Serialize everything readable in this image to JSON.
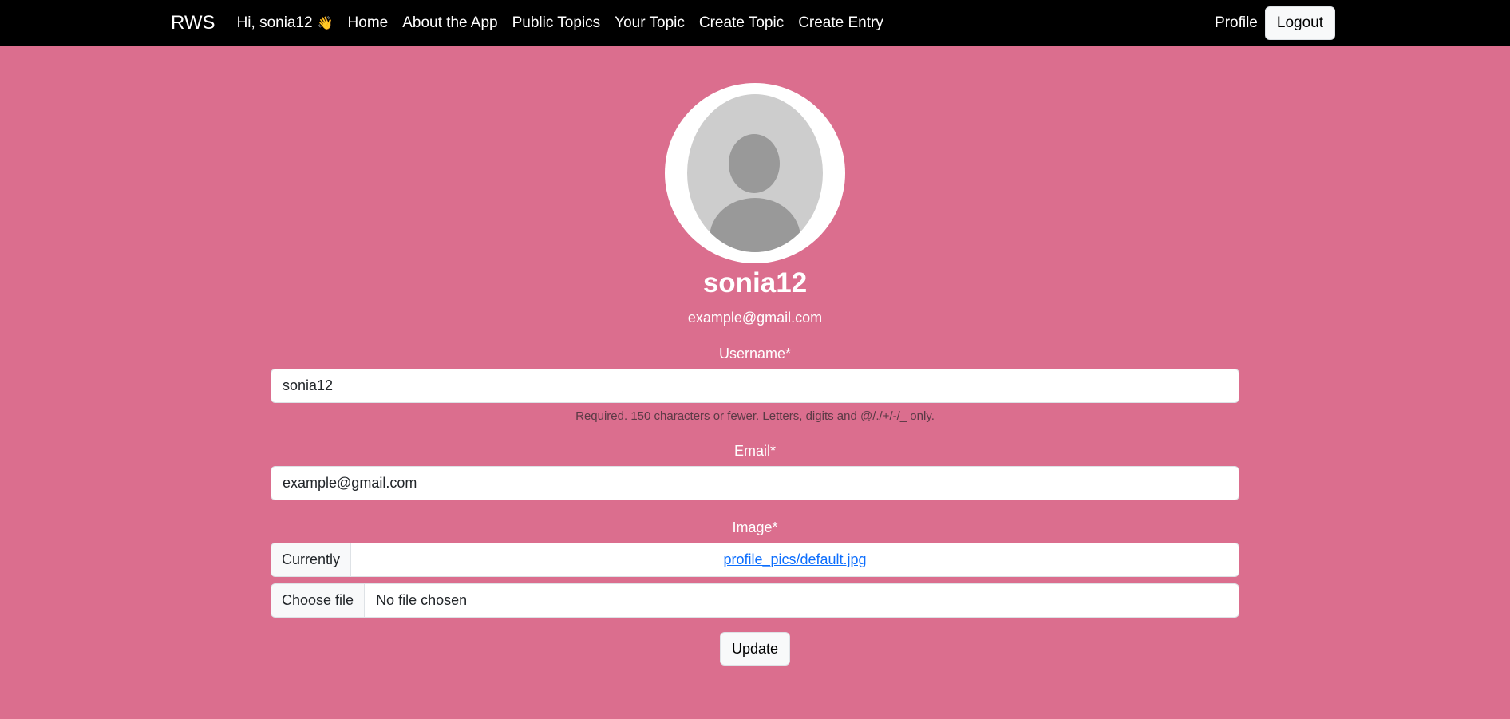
{
  "nav": {
    "brand": "RWS",
    "greeting": "Hi, sonia12",
    "greeting_emoji": "👋",
    "links": [
      "Home",
      "About the App",
      "Public Topics",
      "Your Topic",
      "Create Topic",
      "Create Entry"
    ],
    "profile": "Profile",
    "logout": "Logout"
  },
  "profile": {
    "username": "sonia12",
    "email": "example@gmail.com",
    "avatar_icon": "default-user-avatar"
  },
  "form": {
    "username_label": "Username*",
    "username_value": "sonia12",
    "username_help": "Required. 150 characters or fewer. Letters, digits and @/./+/-/_ only.",
    "email_label": "Email*",
    "email_value": "example@gmail.com",
    "image_label": "Image*",
    "currently_label": "Currently",
    "current_image": "profile_pics/default.jpg",
    "choose_file": "Choose file",
    "no_file": "No file chosen",
    "update": "Update"
  },
  "colors": {
    "background": "#db6e8e",
    "navbar": "#000000",
    "link": "#0d6efd"
  }
}
